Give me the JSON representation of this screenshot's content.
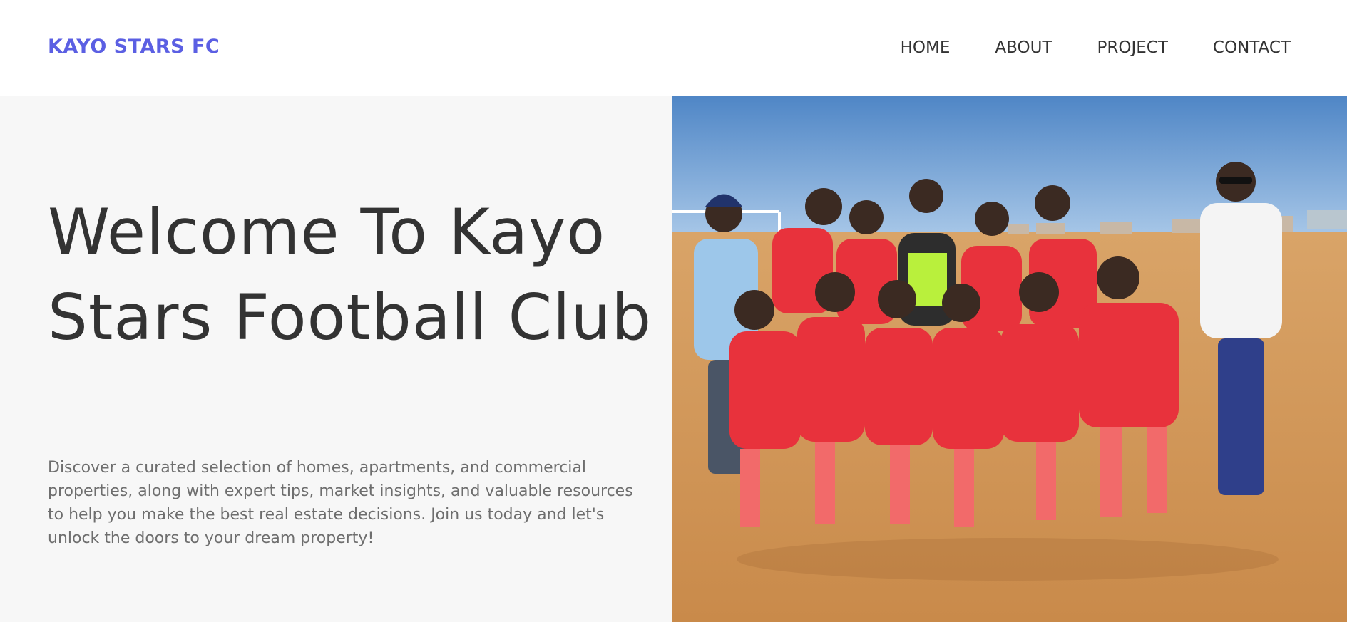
{
  "nav": {
    "brand": "KAYO STARS FC",
    "links": [
      "HOME",
      "ABOUT",
      "PROJECT",
      "CONTACT"
    ]
  },
  "hero": {
    "title": "Welcome To Kayo Stars Football Club",
    "description": "Discover a curated selection of homes, apartments, and commercial properties, along with expert tips, market insights, and valuable resources to help you make the best real estate decisions. Join us today and let's unlock the doors to your dream property!"
  },
  "colors": {
    "brand": "#5b5fe3",
    "hero_bg": "#f7f7f7",
    "jersey": "#e8323c"
  }
}
